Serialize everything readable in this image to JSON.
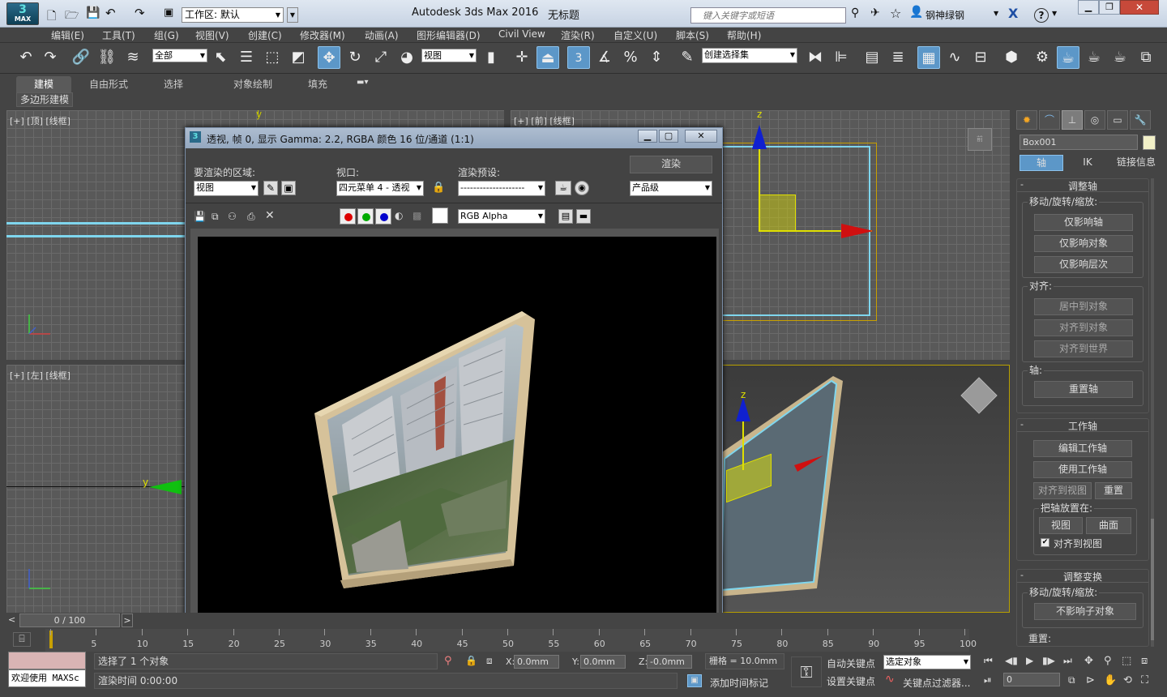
{
  "window": {
    "app_title": "Autodesk 3ds Max 2016",
    "doc_title": "无标题",
    "workspace_label": "工作区: 默认",
    "search_placeholder": "键入关键字或短语",
    "user": "钢神绿钢",
    "help": "?"
  },
  "menu": [
    "编辑(E)",
    "工具(T)",
    "组(G)",
    "视图(V)",
    "创建(C)",
    "修改器(M)",
    "动画(A)",
    "图形编辑器(D)",
    "Civil View",
    "渲染(R)",
    "自定义(U)",
    "脚本(S)",
    "帮助(H)"
  ],
  "toolbar": {
    "selection_filter": "全部",
    "reference_coord": "视图",
    "snap_value": "3",
    "named_selection": "创建选择集"
  },
  "ribbon": {
    "tabs": [
      "建模",
      "自由形式",
      "选择",
      "对象绘制",
      "填充"
    ],
    "active_tab": "建模",
    "sub_label": "多边形建模"
  },
  "viewports": {
    "top": "[+] [顶] [线框]",
    "front": "[+] [前] [线框]",
    "left": "[+] [左] [线框]",
    "front_axis_z": "z",
    "top_axis_y": "y",
    "persp_axis_z": "z",
    "left_axis_y": "y"
  },
  "render_window": {
    "title": "透视, 帧 0, 显示 Gamma: 2.2, RGBA 颜色 16 位/通道 (1:1)",
    "area_label": "要渲染的区域:",
    "area_value": "视图",
    "viewport_label": "视口:",
    "viewport_value": "四元菜单 4 - 透视",
    "preset_label": "渲染预设:",
    "preset_value": "--------------------",
    "render_button": "渲染",
    "quality_value": "产品级",
    "channel_value": "RGB Alpha"
  },
  "command_panel": {
    "object_name": "Box001",
    "tabs": [
      "轴",
      "IK",
      "链接信息"
    ],
    "active_tab": "轴",
    "rollout_adjust_pivot": "调整轴",
    "group_move_rotate": "移动/旋转/缩放:",
    "btn_pivot_only": "仅影响轴",
    "btn_object_only": "仅影响对象",
    "btn_hierarchy_only": "仅影响层次",
    "group_align": "对齐:",
    "btn_center_to_obj": "居中到对象",
    "btn_align_to_obj": "对齐到对象",
    "btn_align_to_world": "对齐到世界",
    "group_pivot": "轴:",
    "btn_reset_pivot": "重置轴",
    "rollout_working_pivot": "工作轴",
    "btn_edit_wp": "编辑工作轴",
    "btn_use_wp": "使用工作轴",
    "btn_align_to_view": "对齐到视图",
    "btn_reset": "重置",
    "group_place_pivot": "把轴放置在:",
    "btn_view": "视图",
    "btn_surface": "曲面",
    "chk_align_view": "对齐到视图",
    "rollout_adjust_transform": "调整变换",
    "group_move_rotate2": "移动/旋转/缩放:",
    "btn_dont_affect_children": "不影响子对象",
    "group_reset": "重置:"
  },
  "timeline": {
    "frame_display": "0 / 100",
    "ticks": [
      "0",
      "5",
      "10",
      "15",
      "20",
      "25",
      "30",
      "35",
      "40",
      "45",
      "50",
      "55",
      "60",
      "65",
      "70",
      "75",
      "80",
      "85",
      "90",
      "95",
      "100"
    ]
  },
  "status": {
    "welcome": "欢迎使用 MAXSc",
    "selected": "选择了 1 个对象",
    "render_time": "渲染时间 0:00:00",
    "x_label": "X:",
    "x_value": "0.0mm",
    "y_label": "Y:",
    "y_value": "0.0mm",
    "z_label": "Z:",
    "z_value": "-0.0mm",
    "grid": "栅格 = 10.0mm",
    "add_time_tag": "添加时间标记",
    "auto_key": "自动关键点",
    "set_key": "设置关键点",
    "selected_object": "选定对象",
    "key_filters": "关键点过滤器...",
    "frame_value": "0"
  },
  "colors": {
    "accent": "#5c97c8",
    "viewport_grid": "#595959",
    "selection_cyan": "#7fd6ee",
    "frame_wood": "#d8c49a"
  }
}
